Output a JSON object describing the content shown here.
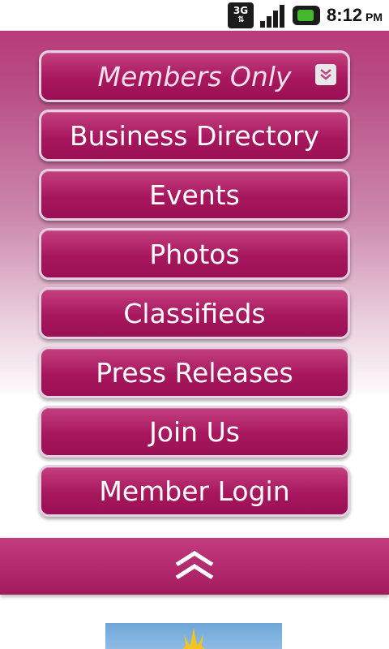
{
  "status_bar": {
    "network": "3G",
    "time": "8:12",
    "ampm": "PM"
  },
  "menu": {
    "items": [
      {
        "label": "Members Only"
      },
      {
        "label": "Business Directory"
      },
      {
        "label": "Events"
      },
      {
        "label": "Photos"
      },
      {
        "label": "Classifieds"
      },
      {
        "label": "Press Releases"
      },
      {
        "label": "Join Us"
      },
      {
        "label": "Member Login"
      }
    ],
    "dropdown_icon": "chevron-double-down-icon"
  },
  "collapse_bar": {
    "icon": "chevron-double-up-icon"
  },
  "colors": {
    "brand": "#a8175e",
    "brand_light": "#c3407f",
    "button_border": "#e6cfe0"
  }
}
